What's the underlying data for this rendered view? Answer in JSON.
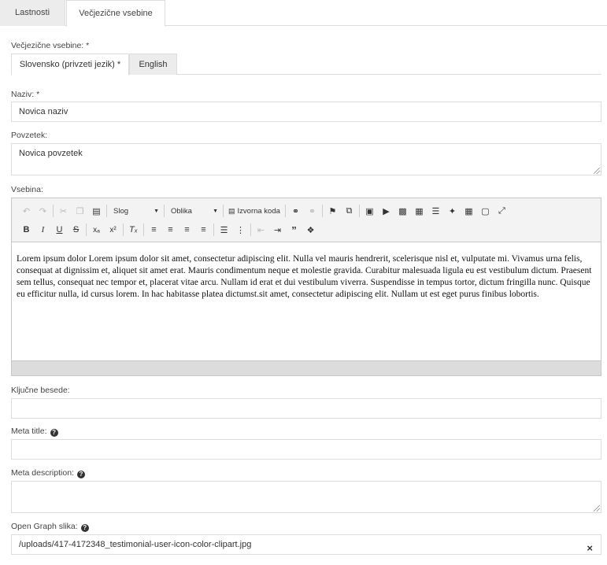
{
  "top_tabs": [
    {
      "label": "Lastnosti"
    },
    {
      "label": "Večjezične vsebine"
    }
  ],
  "multilang_label": "Večjezične vsebine: *",
  "lang_tabs": [
    {
      "label": "Slovensko (privzeti jezik) *"
    },
    {
      "label": "English"
    }
  ],
  "naziv": {
    "label": "Naziv: *",
    "value": "Novica naziv"
  },
  "povzetek": {
    "label": "Povzetek:",
    "value": "Novica povzetek"
  },
  "vsebina": {
    "label": "Vsebina:",
    "toolbar": {
      "style_combo": "Slog",
      "format_combo": "Oblika",
      "source_button": "Izvorna koda"
    },
    "content": "Lorem ipsum dolor Lorem ipsum dolor sit amet, consectetur adipiscing elit. Nulla vel mauris hendrerit, scelerisque nisl et, vulputate mi. Vivamus urna felis, consequat at dignissim et, aliquet sit amet erat. Mauris condimentum neque et molestie gravida. Curabitur malesuada ligula eu est vestibulum dictum. Praesent sem tellus, consequat nec tempor et, placerat vitae arcu. Nullam id erat et dui vestibulum viverra. Suspendisse in tempus tortor, dictum fringilla nunc. Quisque eu efficitur nulla, id cursus lorem. In hac habitasse platea dictumst.sit amet, consectetur adipiscing elit. Nullam ut est eget purus finibus lobortis."
  },
  "kljucne_besede": {
    "label": "Ključne besede:",
    "value": ""
  },
  "meta_title": {
    "label": "Meta title:",
    "value": ""
  },
  "meta_description": {
    "label": "Meta description:",
    "value": ""
  },
  "og_image": {
    "label": "Open Graph slika:",
    "value": "/uploads/417-4172348_testimonial-user-icon-color-clipart.jpg",
    "clear": "×"
  }
}
